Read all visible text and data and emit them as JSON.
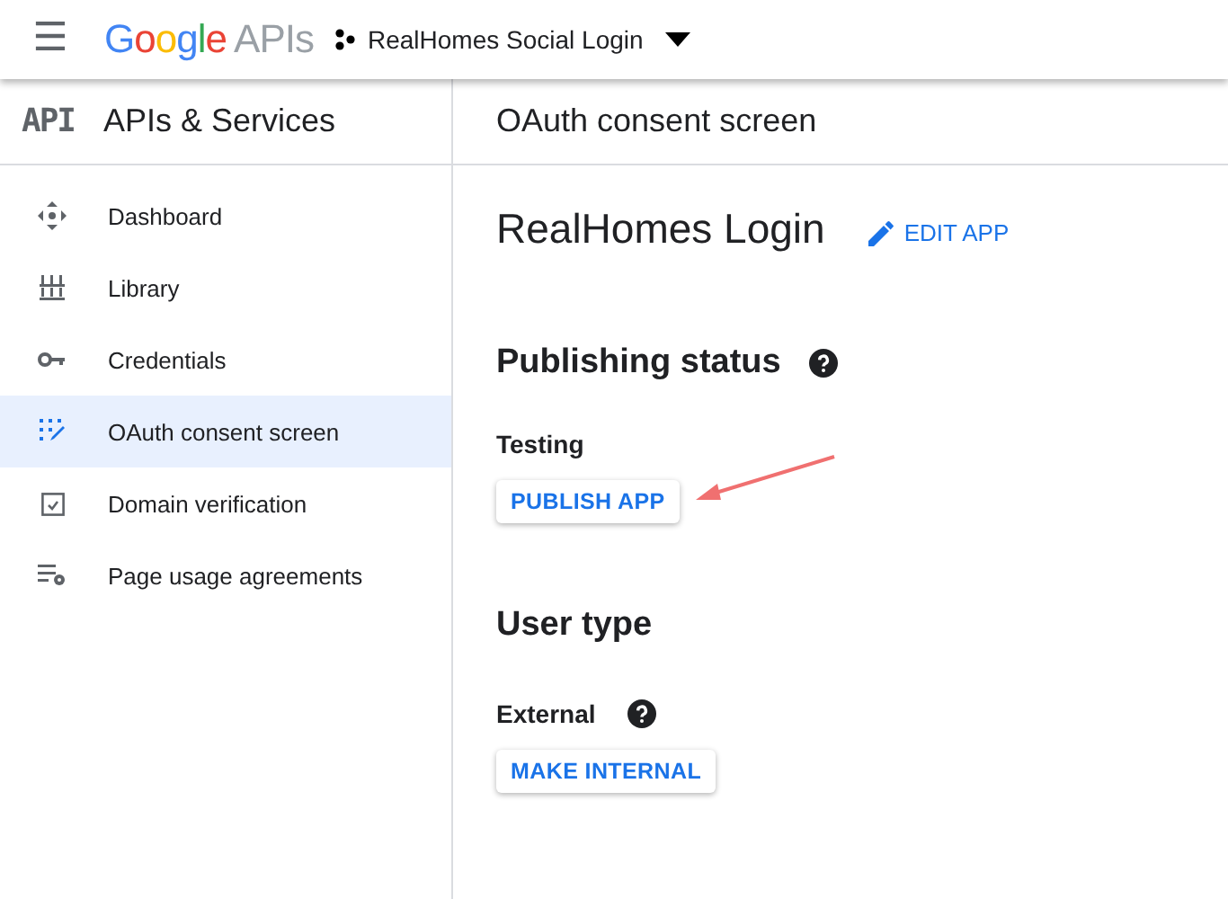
{
  "topbar": {
    "menu_icon": "☰",
    "logo_brand": "Google",
    "logo_product": "APIs",
    "project": "RealHomes Social Login"
  },
  "sidebar": {
    "badge": "API",
    "title": "APIs & Services",
    "items": [
      {
        "label": "Dashboard",
        "selected": false
      },
      {
        "label": "Library",
        "selected": false
      },
      {
        "label": "Credentials",
        "selected": false
      },
      {
        "label": "OAuth consent screen",
        "selected": true
      },
      {
        "label": "Domain verification",
        "selected": false
      },
      {
        "label": "Page usage agreements",
        "selected": false
      }
    ]
  },
  "main": {
    "header": "OAuth consent screen",
    "app_name": "RealHomes Login",
    "edit_button": "EDIT APP",
    "sections": [
      {
        "title": "Publishing status",
        "help": true,
        "status": "Testing",
        "status_help": false,
        "button": "PUBLISH APP",
        "annotated": true
      },
      {
        "title": "User type",
        "help": false,
        "status": "External",
        "status_help": true,
        "button": "MAKE INTERNAL",
        "annotated": false
      }
    ]
  }
}
